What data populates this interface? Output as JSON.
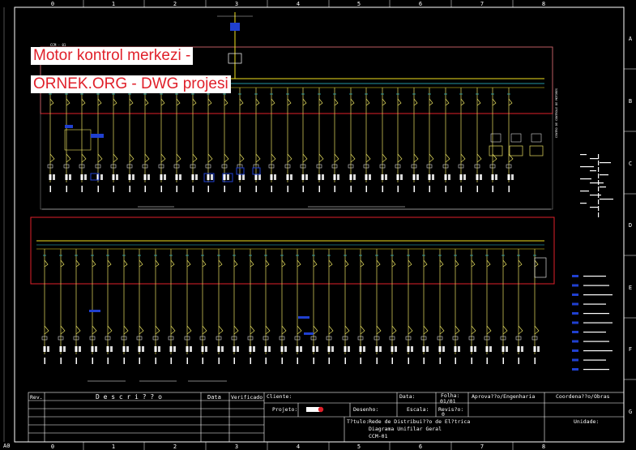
{
  "overlay": {
    "line1": "Motor kontrol merkezi -",
    "line2": "ORNEK.ORG - DWG projesi"
  },
  "border": {
    "columns": [
      "0",
      "1",
      "2",
      "3",
      "4",
      "5",
      "6",
      "7",
      "8"
    ],
    "rows": [
      "A",
      "B",
      "C",
      "D",
      "E",
      "F",
      "G"
    ],
    "sheet_code": "A0"
  },
  "diagram": {
    "top_label": "CCM - 01",
    "vertical_note": "CENTRO DE CONTROLE DE MOTORES"
  },
  "title_block": {
    "rev_header": "Rev.",
    "description_header": "D e s c r i ? ? o",
    "data_header": "Data",
    "verificado_header": "Verificado",
    "cliente_label": "Cliente:",
    "data_label": "Data:",
    "folha_label": "Folha:",
    "folha_value": "01/01",
    "aprovacao_label": "Aprova??o/Engenharia",
    "coordenacao_label": "Coordena??o/Obras",
    "projeto_label": "Projeto:",
    "desenho_label": "Desenho:",
    "escala_label": "Escala:",
    "revisao_label": "Revis?o:",
    "revisao_value": "0",
    "titulo_label": "T?tulo:",
    "titulo_line1": "Rede de Distribui??o de El?trica",
    "titulo_line2": "Diagrama Unifilar Geral",
    "titulo_line3": "CCM-01",
    "unidade_label": "Unidade:"
  },
  "colors": {
    "frame": "#ffffff",
    "panel_border": "#e0202a",
    "busbar": "#f0e020",
    "feeder": "#e8e060",
    "cyan": "#30c8d8",
    "blue": "#2040d0",
    "text_white": "#ffffff"
  }
}
